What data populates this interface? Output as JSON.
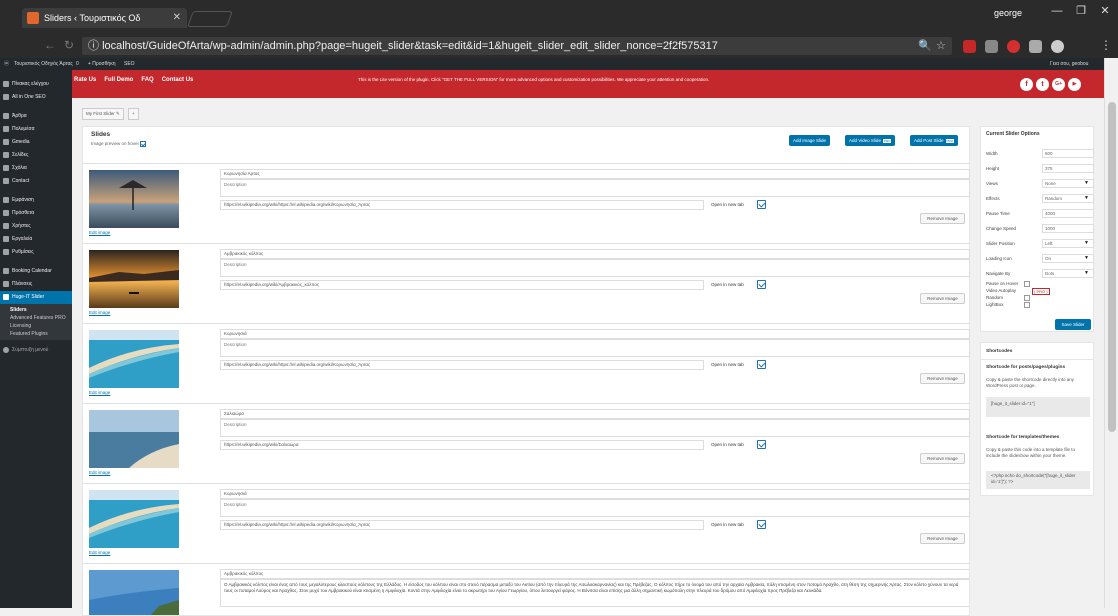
{
  "browser": {
    "tab_title": "Sliders ‹ Τουριστικός Οδ",
    "tab_close": "✕",
    "user": "george",
    "win_min": "—",
    "win_max": "❐",
    "win_close": "✕",
    "url": "localhost/GuideOfArta/wp-admin/admin.php?page=hugeit_slider&task=edit&id=1&hugeit_slider_edit_slider_nonce=2f2f575317",
    "back": "←",
    "reload": "↻",
    "info_icon": "ⓘ",
    "zoom_icon": "🔍",
    "star_icon": "☆",
    "menu_icon": "⋮"
  },
  "adminbar": {
    "site": "Τουριστικός Οδηγός Άρτας",
    "comments": "0",
    "new": "+ Προσθήκη",
    "seo": "SEO",
    "greeting": "Γεια σου, geobou"
  },
  "sidebar": {
    "items": [
      {
        "label": "Πίνακας ελέγχου"
      },
      {
        "label": "All in One SEO"
      },
      {
        "label": "Άρθρα"
      },
      {
        "label": "Πολυμέσα"
      },
      {
        "label": "Gmedia"
      },
      {
        "label": "Σελίδες"
      },
      {
        "label": "Σχόλια"
      },
      {
        "label": "Contact"
      },
      {
        "label": "Εμφάνιση"
      },
      {
        "label": "Πρόσθετα"
      },
      {
        "label": "Χρήστες"
      },
      {
        "label": "Εργαλεία"
      },
      {
        "label": "Ρυθμίσεις"
      },
      {
        "label": "Booking Calendar"
      },
      {
        "label": "Πλάνσεις"
      },
      {
        "label": "Huge-IT Slider"
      }
    ],
    "sub": [
      "Sliders",
      "Advanced Features PRO",
      "Licensing",
      "Featured Plugins"
    ],
    "collapse": "Σύμπτυξη μενού"
  },
  "banner": {
    "links": [
      "Rate Us",
      "Full Demo",
      "FAQ",
      "Contact Us"
    ],
    "message": "This is the Lite version of the plugin. Click \"GET THE FULL VERSION\" for more advanced options and customization possibilities. We appreciate your attention and cooperation.",
    "socials": [
      "f",
      "t",
      "G+",
      "▶"
    ]
  },
  "slider_tabs": {
    "name": "My First Slider",
    "add": "+"
  },
  "slides_panel": {
    "title": "Slides",
    "preview_label": "Image preview on hover",
    "btn_add_image": "Add Image Slide",
    "btn_add_video": "Add Video Slide",
    "btn_add_post": "Add Post Slide",
    "pro": "PRO",
    "edit_image": "Edit image",
    "description_placeholder": "Description",
    "open_new_tab": "Open in new tab",
    "remove_image": "Remove Image"
  },
  "slides": [
    {
      "title": "Κορωνησία Άρτας",
      "url": "https://el.wikipedia.org/wiki/https://el.wikipedia.org/wiki/Κορωνησία_Άρτας"
    },
    {
      "title": "Αμβρακικός κόλπος",
      "url": "https://el.wikipedia.org/wiki/Αμβρακικός_κόλπος"
    },
    {
      "title": "Κορωνησιά",
      "url": "https://el.wikipedia.org/wiki/https://el.wikipedia.org/wiki/Κορωνησία_Άρτας"
    },
    {
      "title": "Σαλιαώρα",
      "url": "https://el.wikipedia.org/wiki/Σαλιαώρα"
    },
    {
      "title": "Κορωνησιά",
      "url": "https://el.wikipedia.org/wiki/https://el.wikipedia.org/wiki/Κορωνησία_Άρτας"
    },
    {
      "title": "Αμβρακικός κόλπος",
      "description": "Ο Αμβρακικός κόλπος είναι ένας από τους μεγαλύτερους κλειστούς κόλπους της Ελλάδος. Η είσοδος του κόλπου είναι στο στενό πέρασμα μεταξύ του Ακτίου (από την πλευρά της Αιτωλοακαρνανίας) και της Πρέβεζας. Ο κόλπος πήρε το όνομά του από την αρχαία Αμβρακία, πόλη κτισμένη στον ποταμό Άραχθο, στη θέση της σημερινής Άρτας. Στον κόλπο χύνουν τα νερά τους οι ποταμοί Λούρος και Άραχθος. Στον μυχό του Αμβρακικού είναι κτισμένη η Αμφιλοχία. Κοντά στην Αμφιλοχία είναι το ακρωτήρι του Αγίου Γεωργίου, όπου λειτουργεί φάρος. Η Βόνιτσα είναι επίσης μια άλλη σημαντική κωμόπολη στην πλευρά του δρόμου από Αμφιλοχία προς Πρέβεζα και Λευκάδα."
    }
  ],
  "options": {
    "title": "Current Slider Options",
    "width_label": "Width",
    "width": "600",
    "height_label": "Height",
    "height": "375",
    "views_label": "Views",
    "views": "None",
    "effects_label": "Effects",
    "effects": "Random",
    "pause_label": "Pause Time",
    "pause": "4000",
    "change_label": "Change Speed",
    "change": "1000",
    "position_label": "Slider Position",
    "position": "Left",
    "loading_label": "Loading Icon",
    "loading": "On",
    "navigate_label": "Navigate By",
    "navigate": "Dots",
    "hover_label": "Pause on Hover",
    "autoplay_label": "Video Autoplay",
    "random_label": "Random",
    "lightbox_label": "LightBox",
    "pro": "( PRO )",
    "save": "Save Slider"
  },
  "shortcodes": {
    "title": "Shortcodes",
    "posts_title": "Shortcode for posts/pages/plugins",
    "posts_text": "Copy & paste the shortcode directly into any WordPress post or page.",
    "posts_code": "[huge_it_slider id=\"1\"]",
    "themes_title": "Shortcode for templates/themes",
    "themes_text": "Copy & paste this code into a template file to include the slideshow within your theme.",
    "themes_code": "<?php echo do_shortcode(\"[huge_it_slider id='1']\"); ?>"
  },
  "colors": {
    "accent": "#0073aa",
    "banner": "#c4282d",
    "sidebar": "#23282d"
  }
}
